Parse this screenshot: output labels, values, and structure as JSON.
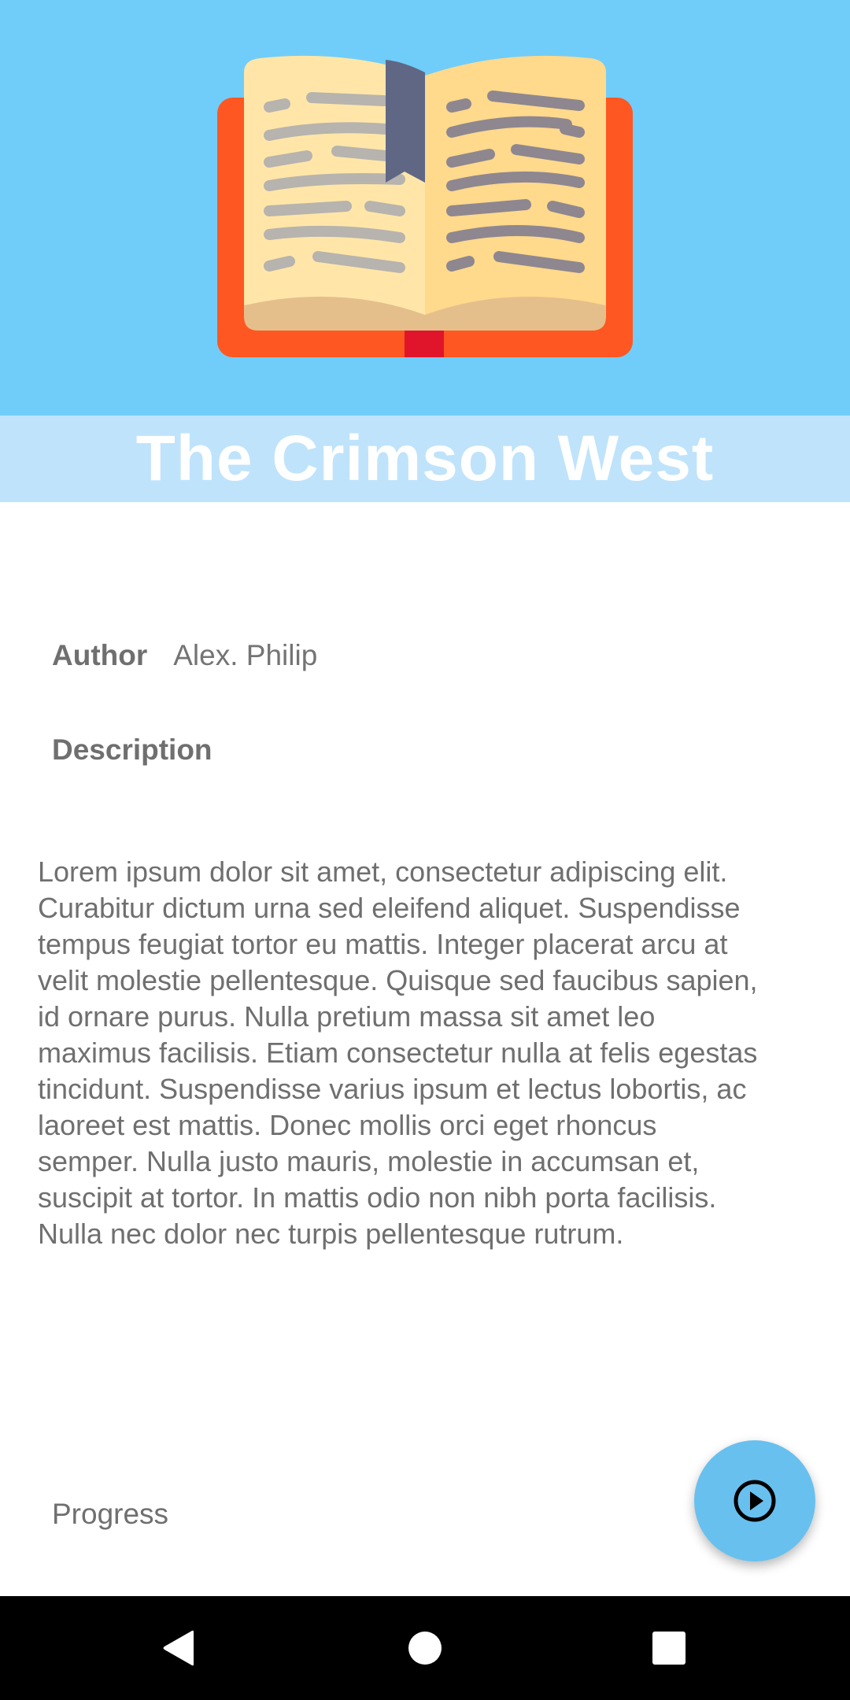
{
  "book": {
    "title": "The Crimson West"
  },
  "details": {
    "author_label": "Author",
    "author_value": "Alex. Philip",
    "description_label": "Description",
    "description_text": "Lorem ipsum dolor sit amet, consectetur adipiscing elit. Curabitur dictum urna sed eleifend aliquet. Suspendisse tempus feugiat tortor eu mattis. Integer placerat arcu at velit molestie pellentesque. Quisque sed faucibus sapien, id ornare purus. Nulla pretium massa sit amet leo maximus facilisis. Etiam consectetur nulla at felis egestas tincidunt. Suspendisse varius ipsum et lectus lobortis, ac laoreet est mattis. Donec mollis orci eget rhoncus semper. Nulla justo mauris, molestie in accumsan et, suscipit at tortor. In mattis odio non nibh porta facilisis. Nulla nec dolor nec turpis pellentesque rutrum.",
    "progress_label": "Progress"
  },
  "fab": {
    "icon": "play-circle-icon"
  },
  "navigation_bar": {
    "back_icon": "back-triangle-icon",
    "home_icon": "home-circle-icon",
    "recents_icon": "recents-square-icon"
  },
  "colors": {
    "hero_background": "#70cdf9",
    "title_bar_background": "#bfe3fb",
    "fab_background": "#68c0ef",
    "book_cover": "#ff5722",
    "bookmark": "#5f6785"
  }
}
